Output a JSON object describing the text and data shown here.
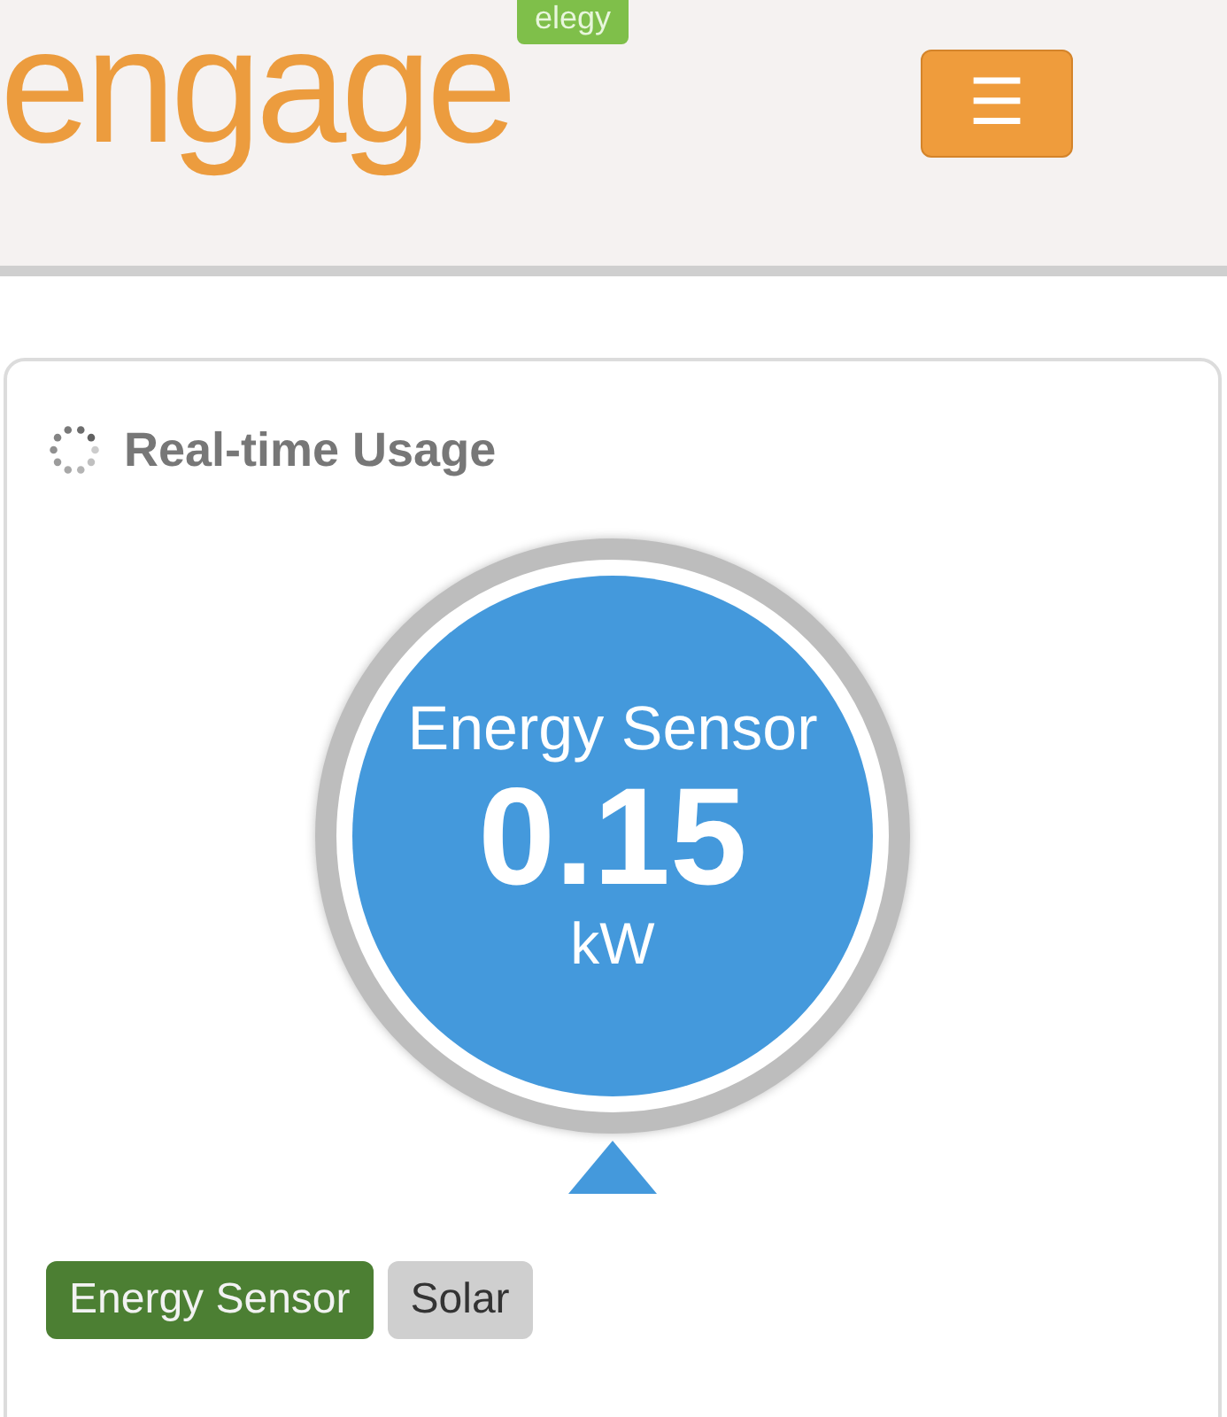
{
  "header": {
    "logo": "engage",
    "logo_badge": "elegy",
    "menu_button": "☰"
  },
  "panel": {
    "title": "Real-time Usage",
    "gauge": {
      "label": "Energy Sensor",
      "value": "0.15",
      "unit": "kW"
    },
    "sources": [
      {
        "label": "Energy Sensor",
        "selected": true
      },
      {
        "label": "Solar",
        "selected": false
      }
    ]
  }
}
